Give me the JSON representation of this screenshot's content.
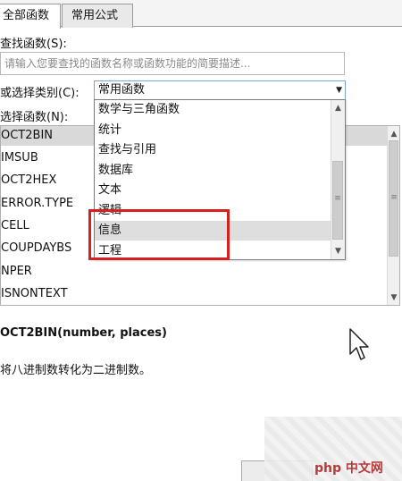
{
  "tabs": [
    {
      "label": "全部函数"
    },
    {
      "label": "常用公式"
    }
  ],
  "search": {
    "label": "查找函数(S):",
    "placeholder": "请输入您要查找的函数名称或函数功能的简要描述..."
  },
  "category": {
    "label": "或选择类别(C):",
    "selected": "常用函数",
    "options": [
      "数学与三角函数",
      "统计",
      "查找与引用",
      "数据库",
      "文本",
      "逻辑",
      "信息",
      "工程"
    ],
    "highlighted": "信息"
  },
  "functions": {
    "label": "选择函数(N):",
    "items": [
      "OCT2BIN",
      "IMSUB",
      "OCT2HEX",
      "ERROR.TYPE",
      "CELL",
      "COUPDAYBS",
      "NPER",
      "ISNONTEXT"
    ],
    "selected": "OCT2BIN"
  },
  "detail": {
    "signature": "OCT2BIN(number, places)",
    "description": "将八进制数转化为二进制数。"
  },
  "watermark": {
    "text": "php 中文网"
  },
  "colors": {
    "highlight_box": "#d42020",
    "selected_row": "#d9d9d9"
  }
}
